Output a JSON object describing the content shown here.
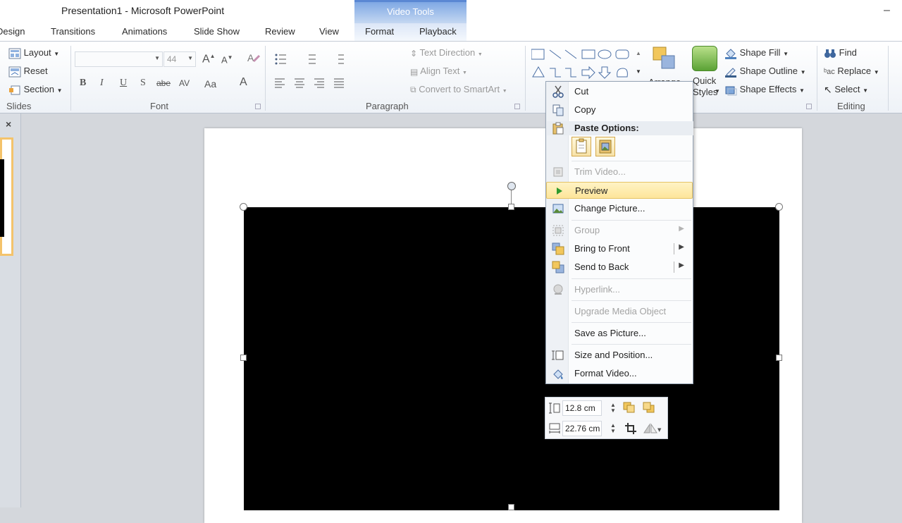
{
  "window": {
    "title": "Presentation1  -  Microsoft PowerPoint",
    "context_tab_group": "Video Tools",
    "minimize_glyph": "–"
  },
  "tabs": [
    {
      "label": "Design"
    },
    {
      "label": "Transitions"
    },
    {
      "label": "Animations"
    },
    {
      "label": "Slide Show"
    },
    {
      "label": "Review"
    },
    {
      "label": "View"
    },
    {
      "label": "Format"
    },
    {
      "label": "Playback"
    }
  ],
  "ribbon": {
    "slides": {
      "label": "Slides",
      "layout": "Layout",
      "reset": "Reset",
      "section": "Section"
    },
    "font": {
      "label": "Font",
      "font_name": "",
      "font_size": "44",
      "bold": "B",
      "italic": "I",
      "underline": "U",
      "strikethrough": "S",
      "abc": "abe",
      "spacing": "AV",
      "case": "Aa",
      "color": "A"
    },
    "paragraph": {
      "label": "Paragraph",
      "text_direction": "Text Direction",
      "align_text": "Align Text",
      "convert_smartart": "Convert to SmartArt"
    },
    "drawing": {
      "arrange": "Arrange",
      "quick_styles_line1": "Quick",
      "quick_styles_line2": "Styles",
      "shape_fill": "Shape Fill",
      "shape_outline": "Shape Outline",
      "shape_effects": "Shape Effects"
    },
    "editing": {
      "label": "Editing",
      "find": "Find",
      "replace": "Replace",
      "select": "Select"
    }
  },
  "context_menu": {
    "cut": "Cut",
    "copy": "Copy",
    "paste_options": "Paste Options:",
    "trim_video": "Trim Video...",
    "preview": "Preview",
    "change_picture": "Change Picture...",
    "group": "Group",
    "bring_to_front": "Bring to Front",
    "send_to_back": "Send to Back",
    "hyperlink": "Hyperlink...",
    "upgrade_media": "Upgrade Media Object",
    "save_as_picture": "Save as Picture...",
    "size_position": "Size and Position...",
    "format_video": "Format Video..."
  },
  "size_toolbar": {
    "height": "12.8 cm",
    "width": "22.76 cm"
  },
  "left_panel": {
    "close_glyph": "×"
  },
  "colors": {
    "accent_blue": "#5a87d3",
    "highlight": "#fde59a",
    "video_fill": "#000000"
  }
}
